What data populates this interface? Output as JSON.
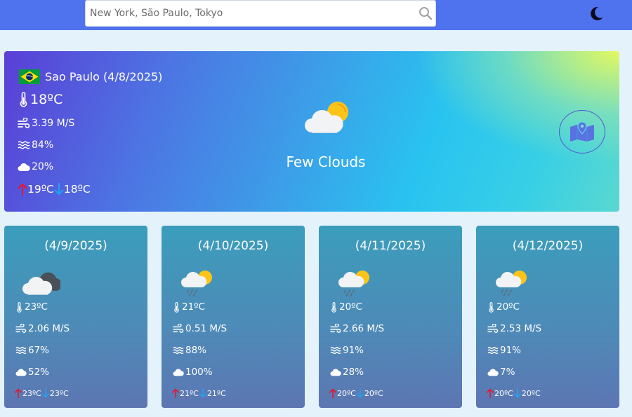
{
  "search": {
    "placeholder": "New York, São Paulo, Tokyo",
    "value": ""
  },
  "colors": {
    "topbar": "#4f72ee",
    "page_bg": "#e4f2fb",
    "max_arrow": "#e8142b",
    "min_arrow": "#1fa3f2"
  },
  "icons": {
    "search": "search-icon",
    "theme": "moon-icon",
    "temp": "thermometer-icon",
    "wind": "wind-icon",
    "humidity": "humidity-waves-icon",
    "clouds": "cloud-icon",
    "max": "arrow-up-icon",
    "min": "arrow-down-icon",
    "map": "map-icon",
    "flag": "brazil-flag-icon"
  },
  "current": {
    "city": "Sao Paulo (4/8/2025)",
    "temp": "18ºC",
    "wind": "3.39 M/S",
    "humidity": "84%",
    "clouds": "20%",
    "max": "19ºC",
    "min": "18ºC",
    "description": "Few Clouds",
    "weather_icon": "few-clouds-icon"
  },
  "forecast": [
    {
      "date": "(4/9/2025)",
      "temp": "23ºC",
      "wind": "2.06 M/S",
      "humidity": "67%",
      "clouds": "52%",
      "max": "23ºC",
      "min": "23ºC",
      "weather_icon": "broken-clouds-icon"
    },
    {
      "date": "(4/10/2025)",
      "temp": "21ºC",
      "wind": "0.51 M/S",
      "humidity": "88%",
      "clouds": "100%",
      "max": "21ºC",
      "min": "21ºC",
      "weather_icon": "light-rain-icon"
    },
    {
      "date": "(4/11/2025)",
      "temp": "20ºC",
      "wind": "2.66 M/S",
      "humidity": "91%",
      "clouds": "28%",
      "max": "20ºC",
      "min": "20ºC",
      "weather_icon": "light-rain-icon"
    },
    {
      "date": "(4/12/2025)",
      "temp": "20ºC",
      "wind": "2.53 M/S",
      "humidity": "91%",
      "clouds": "7%",
      "max": "20ºC",
      "min": "20ºC",
      "weather_icon": "light-rain-icon"
    }
  ]
}
